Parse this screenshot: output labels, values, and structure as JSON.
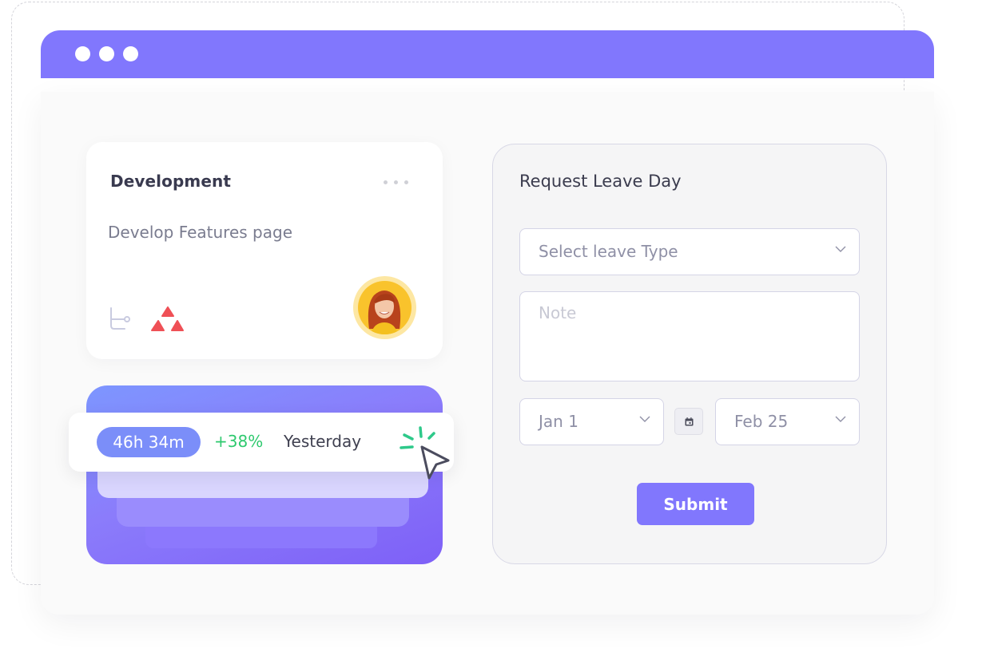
{
  "window": {
    "controls": [
      "dot",
      "dot",
      "dot"
    ],
    "accent_color": "#8177fd"
  },
  "task_card": {
    "title": "Development",
    "description": "Develop Features page",
    "icons": [
      "more-icon",
      "tree-branch-icon",
      "triangles-logo-icon"
    ],
    "avatar": "user-avatar"
  },
  "stats": {
    "duration": "46h 34m",
    "change": "+38%",
    "period": "Yesterday",
    "change_color": "#2ec96e"
  },
  "leave_form": {
    "title": "Request Leave Day",
    "leave_type_placeholder": "Select leave Type",
    "note_placeholder": "Note",
    "start_date": "Jan 1",
    "end_date": "Feb 25",
    "submit_label": "Submit"
  }
}
